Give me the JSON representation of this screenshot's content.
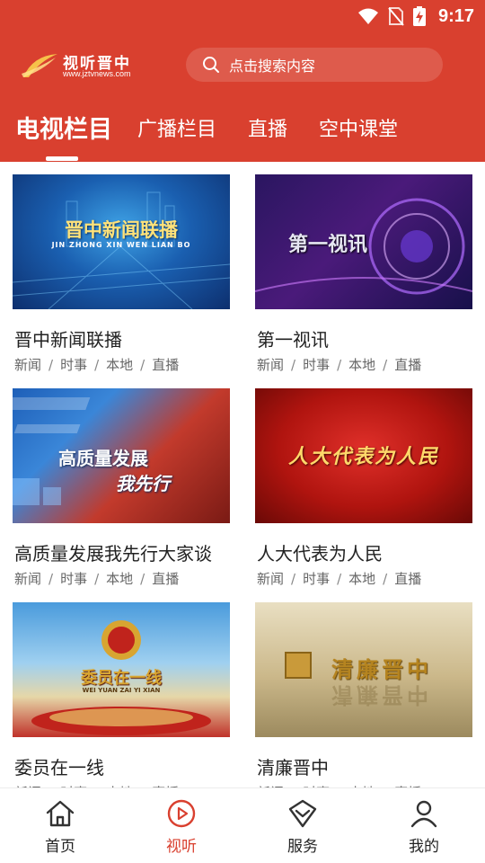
{
  "status_bar": {
    "time": "9:17"
  },
  "header": {
    "logo_title": "视听晋中",
    "logo_url": "www.jztvnews.com",
    "search_placeholder": "点击搜索内容"
  },
  "tabs": [
    {
      "label": "电视栏目",
      "active": true
    },
    {
      "label": "广播栏目",
      "active": false
    },
    {
      "label": "直播",
      "active": false
    },
    {
      "label": "空中课堂",
      "active": false
    }
  ],
  "programs": [
    {
      "title": "晋中新闻联播",
      "thumb_text": "晋中新闻联播",
      "thumb_subtext": "JIN ZHONG XIN WEN LIAN BO",
      "tags": [
        "新闻",
        "时事",
        "本地",
        "直播"
      ]
    },
    {
      "title": "第一视讯",
      "thumb_text": "第一视讯",
      "tags": [
        "新闻",
        "时事",
        "本地",
        "直播"
      ]
    },
    {
      "title": "高质量发展我先行大家谈",
      "thumb_text": "高质量发展",
      "thumb_text2": "我先行",
      "tags": [
        "新闻",
        "时事",
        "本地",
        "直播"
      ]
    },
    {
      "title": "人大代表为人民",
      "thumb_text": "人大代表为人民",
      "tags": [
        "新闻",
        "时事",
        "本地",
        "直播"
      ]
    },
    {
      "title": "委员在一线",
      "thumb_text": "委员在一线",
      "thumb_subtext": "WEI YUAN ZAI YI XIAN",
      "tags": [
        "新闻",
        "时事",
        "本地",
        "直播"
      ]
    },
    {
      "title": "清廉晋中",
      "thumb_text": "清廉晋中",
      "tags": [
        "新闻",
        "时事",
        "本地",
        "直播"
      ]
    }
  ],
  "bottom_nav": [
    {
      "label": "首页",
      "icon": "home-icon",
      "active": false
    },
    {
      "label": "视听",
      "icon": "play-icon",
      "active": true
    },
    {
      "label": "服务",
      "icon": "service-icon",
      "active": false
    },
    {
      "label": "我的",
      "icon": "profile-icon",
      "active": false
    }
  ],
  "colors": {
    "brand": "#d9402f",
    "text": "#222222",
    "tag": "#666666"
  }
}
